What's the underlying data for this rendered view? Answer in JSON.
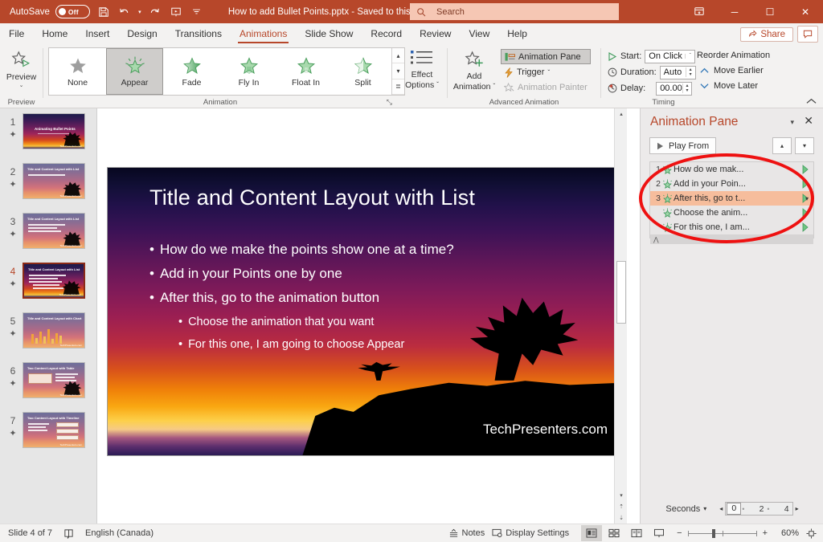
{
  "titlebar": {
    "autosave_label": "AutoSave",
    "autosave_state": "Off",
    "save_icon": "save-icon",
    "undo_icon": "undo-icon",
    "redo_icon": "redo-icon",
    "present_icon": "start-presentation-icon",
    "more_icon": "customize-quick-access-icon",
    "document_title": "How to add Bullet Points.pptx  -  Saved to this PC",
    "title_caret": "▾",
    "search_placeholder": "Search",
    "search_icon": "search-icon",
    "ribbon_display_icon": "ribbon-display-options-icon",
    "minimize": "─",
    "maximize": "☐",
    "close": "✕",
    "bg_color": "#b7472a"
  },
  "ribbon_tabs": {
    "items": [
      {
        "label": "File",
        "active": false
      },
      {
        "label": "Home",
        "active": false
      },
      {
        "label": "Insert",
        "active": false
      },
      {
        "label": "Design",
        "active": false
      },
      {
        "label": "Transitions",
        "active": false
      },
      {
        "label": "Animations",
        "active": true
      },
      {
        "label": "Slide Show",
        "active": false
      },
      {
        "label": "Record",
        "active": false
      },
      {
        "label": "Review",
        "active": false
      },
      {
        "label": "View",
        "active": false
      },
      {
        "label": "Help",
        "active": false
      }
    ],
    "share_label": "Share",
    "share_icon": "share-icon",
    "comment_icon": "comment-icon",
    "accent_color": "#b7472a"
  },
  "ribbon": {
    "preview": {
      "button_label": "Preview",
      "group_label": "Preview",
      "icon": "preview-star-play-icon",
      "caret": "⌄"
    },
    "animation": {
      "group_label": "Animation",
      "items": [
        {
          "label": "None",
          "selected": false,
          "icon": "star-none-icon"
        },
        {
          "label": "Appear",
          "selected": true,
          "icon": "star-appear-icon"
        },
        {
          "label": "Fade",
          "selected": false,
          "icon": "star-fade-icon"
        },
        {
          "label": "Fly In",
          "selected": false,
          "icon": "star-flyin-icon"
        },
        {
          "label": "Float In",
          "selected": false,
          "icon": "star-floatin-icon"
        },
        {
          "label": "Split",
          "selected": false,
          "icon": "star-split-icon"
        }
      ],
      "scroll_up": "▴",
      "scroll_down": "▾",
      "scroll_more": "≣",
      "dialog_launcher": "⤡"
    },
    "effect_options": {
      "line1": "Effect",
      "line2": "Options",
      "caret": "ˇ",
      "icon": "effect-options-list-icon"
    },
    "advanced": {
      "group_label": "Advanced Animation",
      "add_animation_label_1": "Add",
      "add_animation_label_2": "Animation",
      "add_animation_caret": "ˇ",
      "add_animation_icon": "add-animation-star-plus-icon",
      "animation_pane_label": "Animation Pane",
      "animation_pane_icon": "animation-pane-icon",
      "animation_pane_toggled": true,
      "trigger_label": "Trigger",
      "trigger_icon": "lightning-bolt-icon",
      "trigger_caret": "ˇ",
      "painter_label": "Animation Painter",
      "painter_icon": "animation-painter-icon",
      "painter_disabled": true
    },
    "timing": {
      "group_label": "Timing",
      "start_label": "Start:",
      "start_value": "On Click",
      "start_icon": "play-triangle-icon",
      "start_caret": "ˇ",
      "duration_label": "Duration:",
      "duration_value": "Auto",
      "duration_icon": "clock-icon",
      "delay_label": "Delay:",
      "delay_value": "00.00",
      "delay_icon": "clock-delay-icon",
      "spin_up": "▴",
      "spin_down": "▾"
    },
    "reorder": {
      "title": "Reorder Animation",
      "move_earlier": "Move Earlier",
      "move_earlier_icon": "chevron-up-icon",
      "move_later": "Move Later",
      "move_later_icon": "chevron-down-icon"
    },
    "collapse_icon": "collapse-ribbon-icon"
  },
  "thumbnails": [
    {
      "number": "1",
      "title": "Animating Bullet Points",
      "selected": false,
      "style": "dark",
      "lines": 1
    },
    {
      "number": "2",
      "title": "Title and Content Layout with List",
      "selected": false,
      "style": "soft",
      "lines": 1
    },
    {
      "number": "3",
      "title": "Title and Content Layout with List",
      "selected": false,
      "style": "soft",
      "lines": 3
    },
    {
      "number": "4",
      "title": "Title and Content Layout with List",
      "selected": true,
      "style": "dark",
      "lines": 5
    },
    {
      "number": "5",
      "title": "Title and Content Layout with Chart",
      "selected": false,
      "style": "soft",
      "lines": 0
    },
    {
      "number": "6",
      "title": "Two Content Layout with Table",
      "selected": false,
      "style": "soft",
      "lines": 3
    },
    {
      "number": "7",
      "title": "Two Content Layout with Timeline",
      "selected": false,
      "style": "soft",
      "lines": 3
    }
  ],
  "slide": {
    "title": "Title and Content Layout with List",
    "bullets": [
      {
        "text": "How do we make the points show one at a time?",
        "level": 1,
        "tag": "1",
        "tag_highlight": false
      },
      {
        "text": "Add in your Points one by one",
        "level": 1,
        "tag": "2",
        "tag_highlight": false
      },
      {
        "text": "After this, go to the animation button",
        "level": 1,
        "tag": "3",
        "tag_highlight": true
      },
      {
        "text": "Choose the animation that you want",
        "level": 2,
        "tag": "3",
        "tag_highlight": false
      },
      {
        "text": "For this one, I am going to choose Appear",
        "level": 2,
        "tag": "3",
        "tag_highlight": false
      }
    ],
    "bullet_char": "•",
    "watermark": "TechPresenters.com"
  },
  "animation_pane": {
    "title": "Animation Pane",
    "menu_caret": "▾",
    "close": "✕",
    "play_button": "Play From",
    "play_icon": "play-triangle-icon",
    "move_up_icon": "▴",
    "move_down_icon": "▾",
    "items": [
      {
        "index": "1",
        "text": "How do we mak...",
        "selected": false
      },
      {
        "index": "2",
        "text": "Add in your Poin...",
        "selected": false
      },
      {
        "index": "3",
        "text": "After this, go to t...",
        "selected": true
      },
      {
        "index": "",
        "text": "Choose the anim...",
        "selected": false
      },
      {
        "index": "",
        "text": "For this one, I am...",
        "selected": false
      }
    ],
    "collapse_icon": "⋀",
    "seconds_label": "Seconds",
    "seconds_caret": "▾",
    "scale_left_arrow": "◂",
    "scale_right_arrow": "▸",
    "scale_ticks": [
      "0",
      "2",
      "4"
    ],
    "selected_bg": "#f6bd9c",
    "title_color": "#b7472a"
  },
  "annotation": {
    "shape": "red-ellipse-highlight",
    "color": "#ee1111"
  },
  "statusbar": {
    "slide_counter": "Slide 4 of 7",
    "accessibility_icon": "accessibility-checker-icon",
    "language": "English (Canada)",
    "notes_label": "Notes",
    "notes_icon": "notes-icon",
    "display_settings_label": "Display Settings",
    "display_settings_icon": "display-settings-icon",
    "views": [
      {
        "name": "normal-view",
        "icon": "normal-view-icon",
        "active": true
      },
      {
        "name": "slide-sorter-view",
        "icon": "slide-sorter-icon",
        "active": false
      },
      {
        "name": "reading-view",
        "icon": "reading-view-icon",
        "active": false
      },
      {
        "name": "slide-show-view",
        "icon": "slide-show-icon",
        "active": false
      }
    ],
    "zoom_out": "−",
    "zoom_in": "+",
    "zoom_level": "60%",
    "fit_slide_icon": "fit-to-window-icon"
  }
}
